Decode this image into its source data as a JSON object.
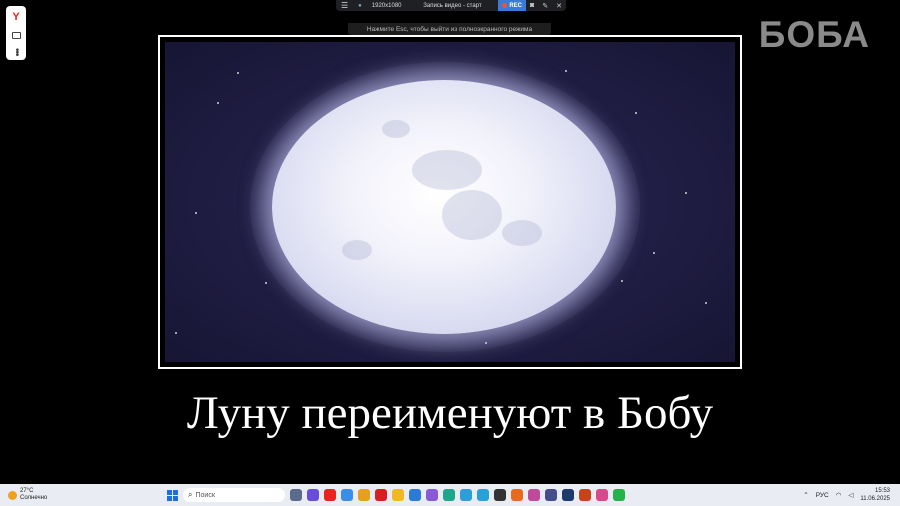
{
  "browser_panel": {
    "yandex_logo_text": "Y"
  },
  "recorder": {
    "resolution": "1920x1080",
    "mode": "Запись видео - старт",
    "rec_label": "REC",
    "hint": "Нажмите Esc, чтобы выйти из полноэкранного режима"
  },
  "watermark": "БОБА",
  "caption": "Луну переименуют в Бобу",
  "taskbar": {
    "weather_temp": "27°C",
    "weather_desc": "Солнечно",
    "search_placeholder": "Поиск",
    "language": "РУС",
    "time": "15:53",
    "date": "11.06.2025",
    "apps": [
      {
        "icon": "taskview-icon",
        "color": "#5b6b8c"
      },
      {
        "icon": "yandex-music-icon",
        "color": "#6a4cdb"
      },
      {
        "icon": "yandex-icon",
        "color": "#e52620"
      },
      {
        "icon": "app-icon",
        "color": "#3a8ee6"
      },
      {
        "icon": "yandex-browser-icon",
        "color": "#e5a020"
      },
      {
        "icon": "opera-icon",
        "color": "#d62020"
      },
      {
        "icon": "explorer-icon",
        "color": "#f2b824"
      },
      {
        "icon": "vk-icon",
        "color": "#2a7ad6"
      },
      {
        "icon": "alice-icon",
        "color": "#8a5ad6"
      },
      {
        "icon": "edge-icon",
        "color": "#1ea58a"
      },
      {
        "icon": "chrome-icon",
        "color": "#2f9ed8"
      },
      {
        "icon": "telegram-icon",
        "color": "#2aa0d8"
      },
      {
        "icon": "obs-icon",
        "color": "#333333"
      },
      {
        "icon": "firefox-icon",
        "color": "#e86a20"
      },
      {
        "icon": "davinci-icon",
        "color": "#c04a9a"
      },
      {
        "icon": "game-icon",
        "color": "#444c8a"
      },
      {
        "icon": "photoshop-icon",
        "color": "#1b3a6b"
      },
      {
        "icon": "powerpoint-icon",
        "color": "#c8421c"
      },
      {
        "icon": "paint-icon",
        "color": "#d44a8a"
      },
      {
        "icon": "whatsapp-icon",
        "color": "#25b24a"
      }
    ]
  }
}
